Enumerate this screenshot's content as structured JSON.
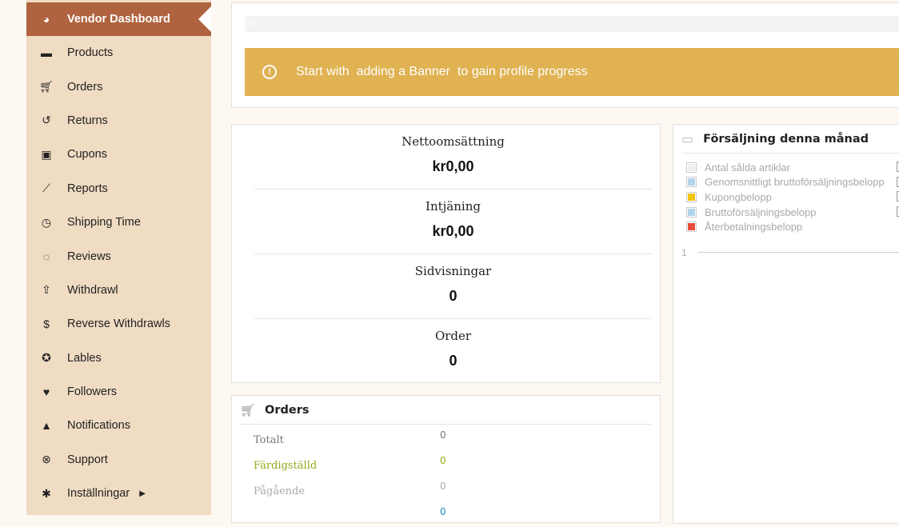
{
  "sidebar": {
    "items": [
      {
        "label": "Vendor Dashboard",
        "icon": "dashboard-icon"
      },
      {
        "label": "Products",
        "icon": "briefcase-icon"
      },
      {
        "label": "Orders",
        "icon": "cart-icon"
      },
      {
        "label": "Returns",
        "icon": "undo-icon"
      },
      {
        "label": "Cupons",
        "icon": "gift-icon"
      },
      {
        "label": "Reports",
        "icon": "chart-line-icon"
      },
      {
        "label": "Shipping Time",
        "icon": "clock-icon"
      },
      {
        "label": "Reviews",
        "icon": "comments-icon"
      },
      {
        "label": "Withdrawl",
        "icon": "upload-icon"
      },
      {
        "label": "Reverse Withdrawls",
        "icon": "dollar-icon"
      },
      {
        "label": "Lables",
        "icon": "award-icon"
      },
      {
        "label": "Followers",
        "icon": "heart-icon"
      },
      {
        "label": "Notifications",
        "icon": "bell-icon"
      },
      {
        "label": "Support",
        "icon": "lifering-icon"
      },
      {
        "label": "Inställningar",
        "icon": "gear-icon"
      }
    ]
  },
  "profile": {
    "progress_percent": 0,
    "progress_label": "0%",
    "banner": "Start with  adding a Banner  to gain profile progress"
  },
  "stats": [
    {
      "label": "Nettoomsättning",
      "value": "kr0,00"
    },
    {
      "label": "Intjäning",
      "value": "kr0,00"
    },
    {
      "label": "Sidvisningar",
      "value": "0"
    },
    {
      "label": "Order",
      "value": "0"
    }
  ],
  "orders": {
    "title": "Orders",
    "rows": [
      {
        "label": "Totalt",
        "value": "0",
        "color": "#777777"
      },
      {
        "label": "Färdigställd",
        "value": "0",
        "color": "#8fae1b"
      },
      {
        "label": "Pågående",
        "value": "0",
        "color": "#aaaaaa"
      },
      {
        "value": "0",
        "color": "#1e8cbe"
      }
    ]
  },
  "sales": {
    "title": "Försäljning denna månad",
    "legend": [
      {
        "label": "Antal sålda artiklar",
        "color": "#ecf0f1"
      },
      {
        "label": "Genomsnittligt bruttoförsäljningsbelopp",
        "color": "#b1d4ea"
      },
      {
        "label": "Kupongbelopp",
        "color": "#f1c40f"
      },
      {
        "label": "Bruttoförsäljningsbelopp",
        "color": "#b1d4ea"
      },
      {
        "label": "Återbetalningsbelopp",
        "color": "#e74c3c"
      }
    ],
    "axis_tick": "1"
  }
}
